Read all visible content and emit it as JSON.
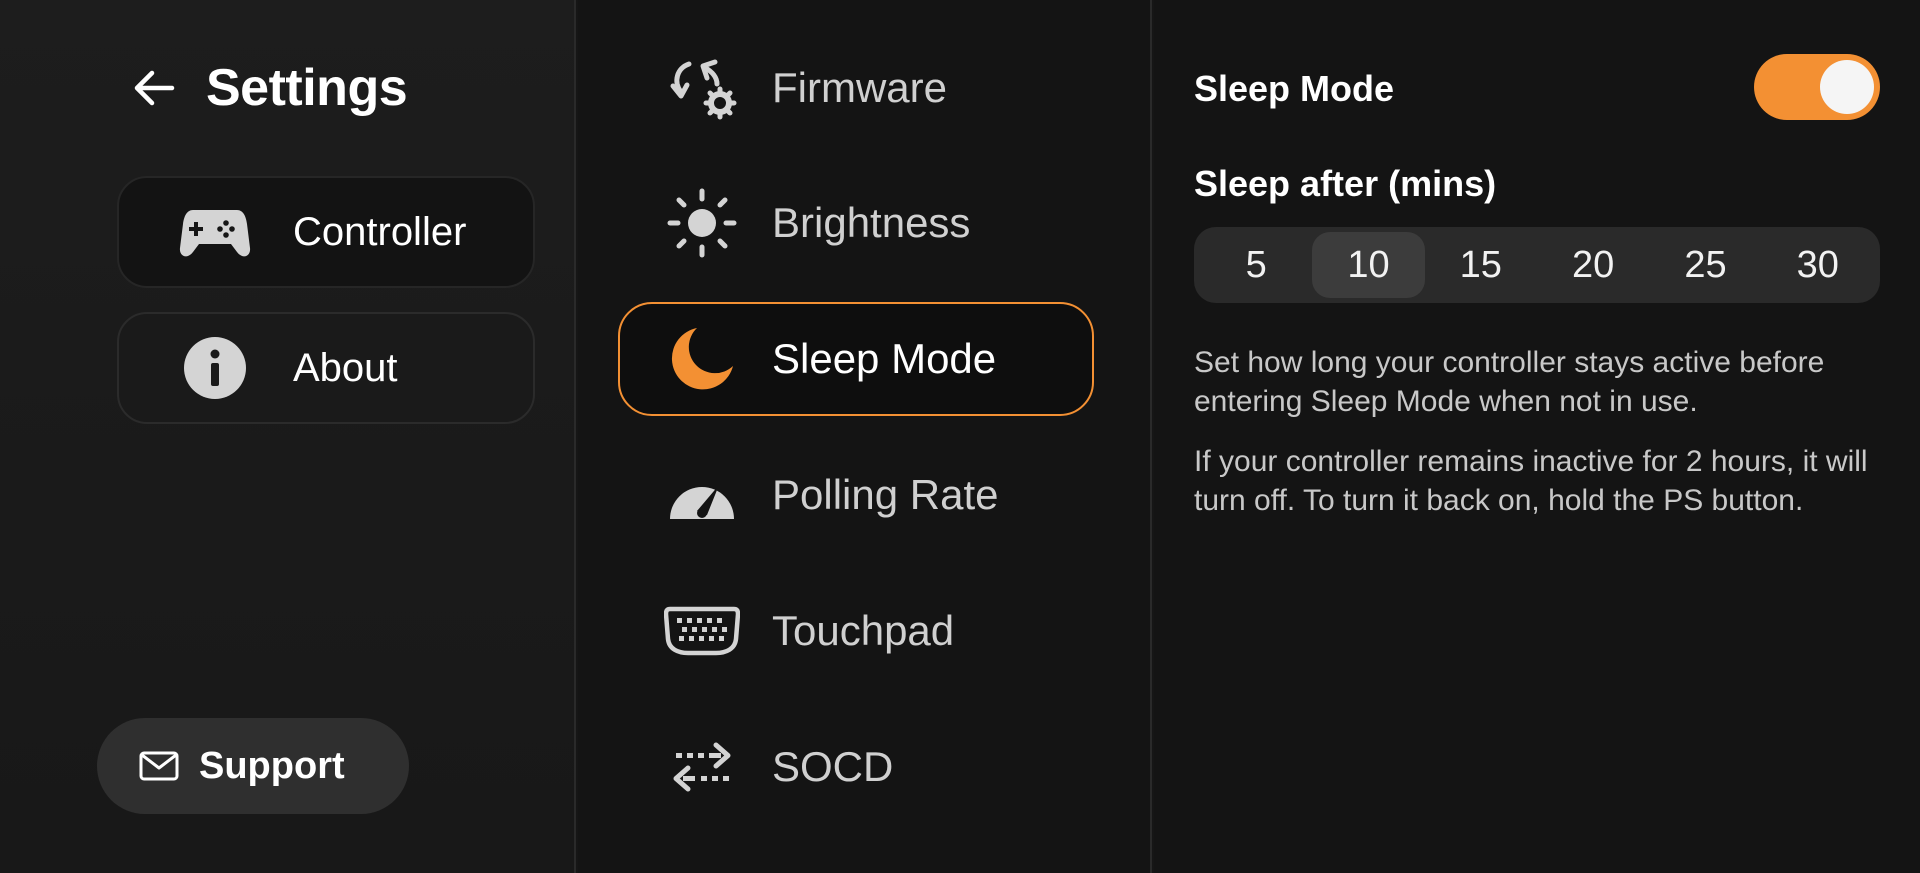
{
  "header": {
    "title": "Settings"
  },
  "sidebar": {
    "items": [
      {
        "id": "controller",
        "label": "Controller",
        "icon": "gamepad-icon"
      },
      {
        "id": "about",
        "label": "About",
        "icon": "info-icon"
      }
    ],
    "support_label": "Support"
  },
  "menu": {
    "items": [
      {
        "id": "firmware",
        "label": "Firmware",
        "icon": "firmware-update-icon"
      },
      {
        "id": "brightness",
        "label": "Brightness",
        "icon": "sun-icon"
      },
      {
        "id": "sleep-mode",
        "label": "Sleep Mode",
        "icon": "moon-icon"
      },
      {
        "id": "polling-rate",
        "label": "Polling Rate",
        "icon": "gauge-icon"
      },
      {
        "id": "touchpad",
        "label": "Touchpad",
        "icon": "touchpad-icon"
      },
      {
        "id": "socd",
        "label": "SOCD",
        "icon": "swap-arrows-icon"
      }
    ],
    "active": "Sleep Mode"
  },
  "detail": {
    "sleep_mode_label": "Sleep Mode",
    "toggle_on": true,
    "sleep_after_label": "Sleep after (mins)",
    "options": [
      "5",
      "10",
      "15",
      "20",
      "25",
      "30"
    ],
    "selected_option": "10",
    "description_1": "Set how long your controller stays active before entering Sleep Mode when not in use.",
    "description_2": "If your controller remains inactive for 2 hours, it will turn off. To turn it back on, hold the PS button."
  },
  "colors": {
    "accent": "#f39033",
    "background": "#141414",
    "icon_gray": "#d4d4d4"
  }
}
